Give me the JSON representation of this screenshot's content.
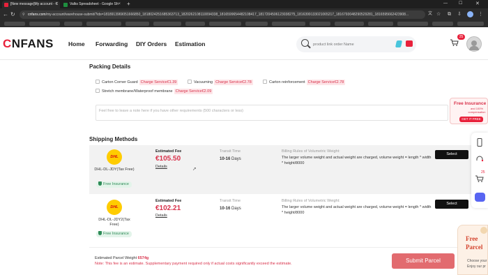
{
  "browser": {
    "tabs": [
      {
        "label": "[New message]My account - C"
      },
      {
        "label": "Valks Spreadsheet - Google Sh"
      }
    ],
    "new_tab": "+",
    "url_host": "cnfans.com",
    "url_path": "/my-account/warehouse-submit/?ids=1818913969051666850_1818024251685363713_1820262108110094338_1816599654482108417_1817204506123038275_1816399133021065217_1816793048290529281_1816595662423908..."
  },
  "header": {
    "logo_c": "C",
    "logo_rest": "NFANS",
    "nav": [
      "Home",
      "Forwarding",
      "DIY Orders",
      "Estimation"
    ],
    "search_placeholder": "product link order Name",
    "cart_count": "25"
  },
  "packing": {
    "title": "Packing Details",
    "options": [
      {
        "label": "Carton Corner Guard",
        "charge": "Charge Service€1.39"
      },
      {
        "label": "Vacuuming",
        "charge": "Charge Service€2.78"
      },
      {
        "label": "Carton reinforcement",
        "charge": "Charge Service€2.78"
      },
      {
        "label": "Stretch membrane/Waterproof membrane",
        "charge": "Charge Service€2.09"
      }
    ],
    "note_placeholder": "Feel free to leave a note here if you have other requirements (500 characters or less)"
  },
  "shipping": {
    "title": "Shipping Methods",
    "methods": [
      {
        "carrier": "DHL-DL-JDY(Tax Free)",
        "insurance": "Free Insurance",
        "fee_label": "Estimated Fee",
        "fee": "€105.50",
        "details": "Details",
        "time_label": "Transit Time",
        "time": "10-16",
        "time_unit": "Days",
        "rules_title": "Billing Rules of Volumetric Weight:",
        "rules_text": "The larger volume weight and actual weight are charged, volume weight = length * width * height/8000",
        "select": "Select"
      },
      {
        "carrier": "DHL-DL-JDY2(Tax Free)",
        "insurance": "Free Insurance",
        "fee_label": "Estimated Fee",
        "fee": "€102.21",
        "details": "Details",
        "time_label": "Transit Time",
        "time": "10-16",
        "time_unit": "Days",
        "rules_title": "Billing Rules of Volumetric Weight:",
        "rules_text": "The larger volume weight and actual weight are charged, volume weight = length * width * height/8000",
        "select": "Select"
      }
    ]
  },
  "footer": {
    "weight_label": "Estimated Parcel Weight",
    "weight": "6574g",
    "note": "Note: This fee is an estimate. Supplementary payment required only if actual costs significantly exceed the estimate.",
    "submit": "Submit Parcel"
  },
  "promo": {
    "title": "Free Insurance",
    "line": "and 100% compensation",
    "cta": "GET IT FREE"
  },
  "promo2": {
    "title1": "Free",
    "title2": "Parcel",
    "line1": "Choose your",
    "line2": "Enjoy our pr"
  },
  "sidebar": {
    "badge": "25"
  },
  "dhl_logo": "DHL",
  "colors": {
    "accent": "#e8213b",
    "price": "#d8314a",
    "insurance": "#2e8b57",
    "submit": "#e26b6f"
  }
}
